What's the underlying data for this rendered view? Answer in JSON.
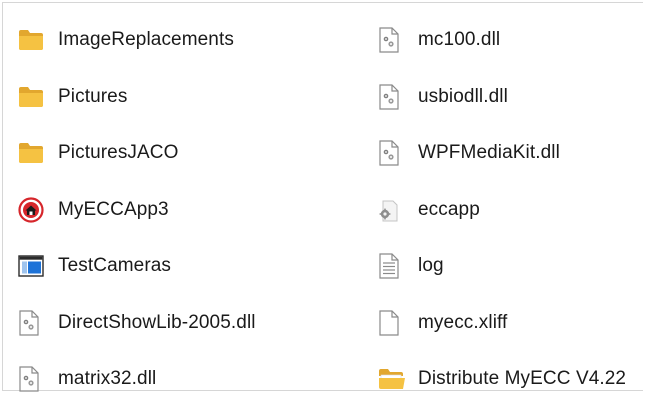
{
  "left_items": [
    {
      "name": "ImageReplacements",
      "icon": "folder-icon"
    },
    {
      "name": "Pictures",
      "icon": "folder-icon"
    },
    {
      "name": "PicturesJACO",
      "icon": "folder-icon"
    },
    {
      "name": "MyECCApp3",
      "icon": "app-shortcut-icon"
    },
    {
      "name": "TestCameras",
      "icon": "window-app-icon"
    },
    {
      "name": "DirectShowLib-2005.dll",
      "icon": "dll-file-icon"
    },
    {
      "name": "matrix32.dll",
      "icon": "dll-file-icon"
    }
  ],
  "right_items": [
    {
      "name": "mc100.dll",
      "icon": "dll-file-icon"
    },
    {
      "name": "usbiodll.dll",
      "icon": "dll-file-icon"
    },
    {
      "name": "WPFMediaKit.dll",
      "icon": "dll-file-icon"
    },
    {
      "name": "eccapp",
      "icon": "config-file-icon"
    },
    {
      "name": "log",
      "icon": "text-file-icon"
    },
    {
      "name": "myecc.xliff",
      "icon": "blank-file-icon"
    },
    {
      "name": "Distribute MyECC V4.22",
      "icon": "open-folder-icon"
    }
  ],
  "colors": {
    "folder": "#F5C242",
    "folder_dark": "#E2A72E",
    "app_red": "#D6262B",
    "window_blue": "#1E73D8"
  }
}
